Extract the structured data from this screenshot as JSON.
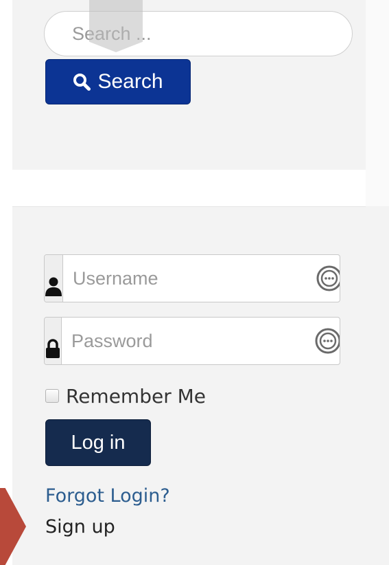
{
  "search": {
    "placeholder": "Search ...",
    "button_label": "Search"
  },
  "login": {
    "username_placeholder": "Username",
    "password_placeholder": "Password",
    "remember_label": "Remember Me",
    "remember_checked": false,
    "login_button_label": "Log in",
    "forgot_link": "Forgot Login?",
    "signup_link": "Sign up"
  },
  "colors": {
    "search_button": "#0c3494",
    "login_button": "#152b4e",
    "link": "#2c5d8f",
    "panel_background": "#f3f3f3",
    "arrow_marker": "#b8493a"
  },
  "icons": {
    "search_button_icon": "magnifier-icon",
    "username_addon_icon": "user-icon",
    "password_addon_icon": "lock-icon",
    "password_manager_icon": "password-manager-icon"
  }
}
